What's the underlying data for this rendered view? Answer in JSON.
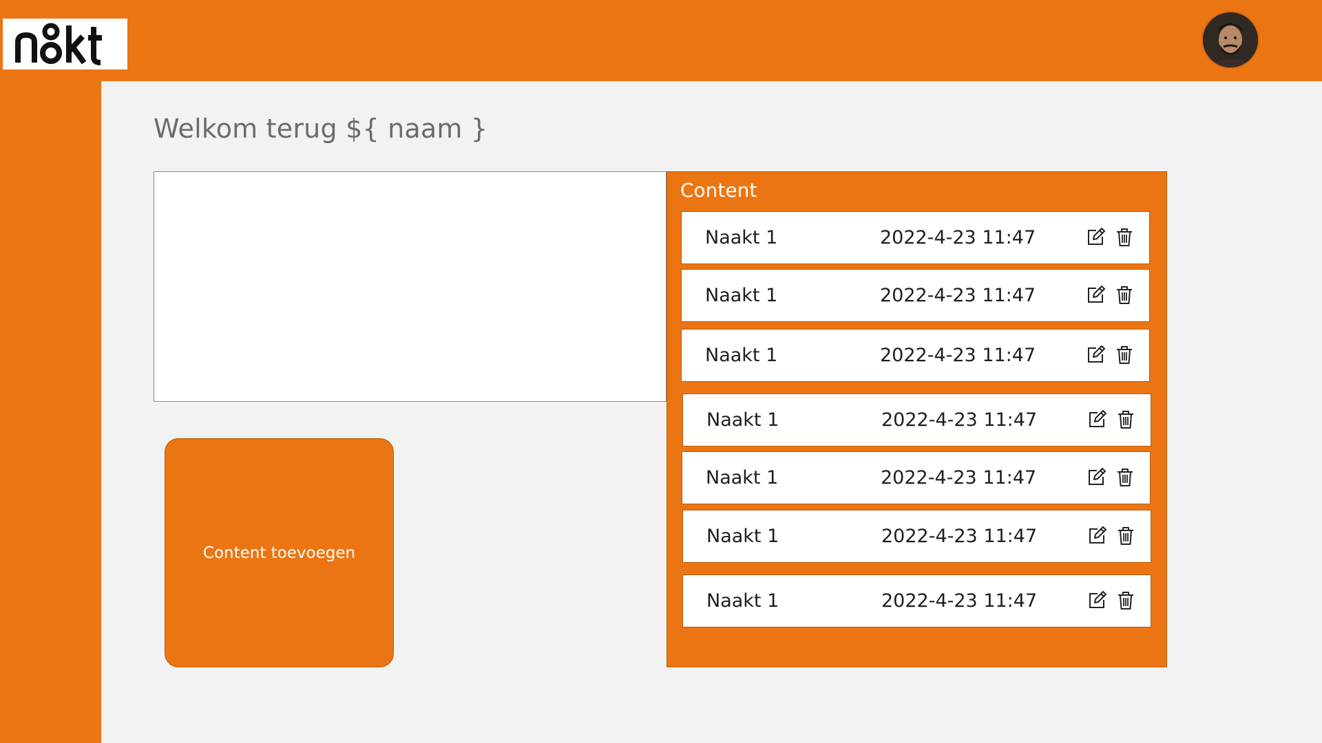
{
  "header": {
    "logo_text": "naakt",
    "avatar_icon": "user-avatar"
  },
  "main": {
    "welcome": "Welkom terug ${ naam }",
    "add_button_label": "Content toevoegen"
  },
  "content_panel": {
    "title": "Content",
    "items": [
      {
        "name": "Naakt 1",
        "date": "2022-4-23 11:47"
      },
      {
        "name": "Naakt 1",
        "date": "2022-4-23 11:47"
      },
      {
        "name": "Naakt 1",
        "date": "2022-4-23 11:47"
      },
      {
        "name": "Naakt 1",
        "date": "2022-4-23 11:47"
      },
      {
        "name": "Naakt 1",
        "date": "2022-4-23 11:47"
      },
      {
        "name": "Naakt 1",
        "date": "2022-4-23 11:47"
      },
      {
        "name": "Naakt 1",
        "date": "2022-4-23 11:47"
      }
    ],
    "row_icons": [
      "edit-icon",
      "trash-icon"
    ]
  },
  "colors": {
    "brand_orange": "#ec7513",
    "background": "#f2f2f2",
    "text_dark": "#1e1e1e",
    "text_muted": "#6b6b6b"
  }
}
